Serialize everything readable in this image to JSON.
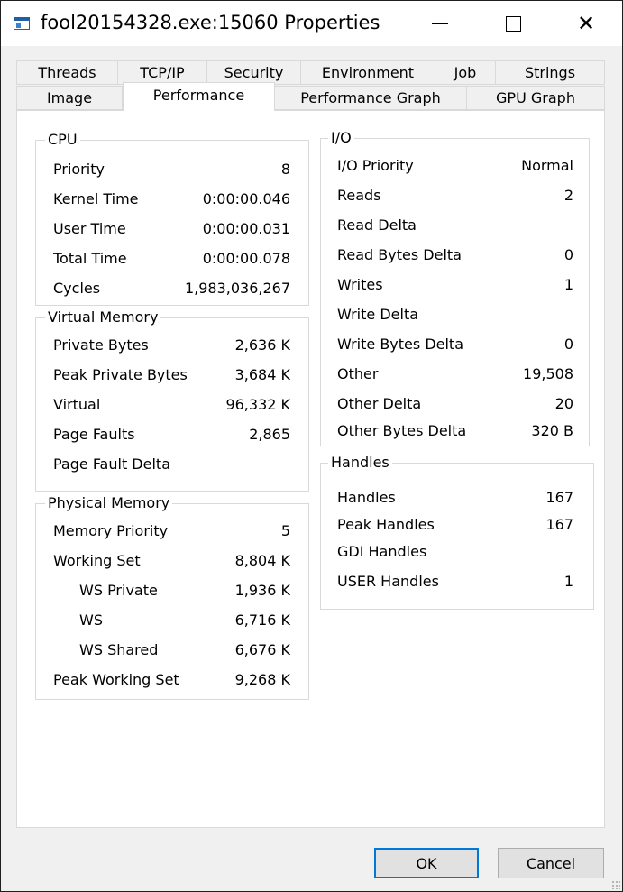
{
  "window": {
    "title": "fool20154328.exe:15060 Properties",
    "minimize_glyph": "",
    "close_glyph": "✕"
  },
  "tabs_row1": [
    "Threads",
    "TCP/IP",
    "Security",
    "Environment",
    "Job",
    "Strings"
  ],
  "tabs_row2": [
    "Image",
    "Performance",
    "Performance Graph",
    "GPU Graph"
  ],
  "active_tab": "Performance",
  "cpu": {
    "title": "CPU",
    "rows": [
      {
        "label": "Priority",
        "value": "8"
      },
      {
        "label": "Kernel Time",
        "value": "0:00:00.046"
      },
      {
        "label": "User Time",
        "value": "0:00:00.031"
      },
      {
        "label": "Total Time",
        "value": "0:00:00.078"
      },
      {
        "label": "Cycles",
        "value": "1,983,036,267"
      }
    ]
  },
  "virtual_memory": {
    "title": "Virtual Memory",
    "rows": [
      {
        "label": "Private Bytes",
        "value": "2,636 K"
      },
      {
        "label": "Peak Private Bytes",
        "value": "3,684 K"
      },
      {
        "label": "Virtual",
        "value": "96,332 K"
      },
      {
        "label": "Page Faults",
        "value": "2,865"
      },
      {
        "label": "Page Fault Delta",
        "value": ""
      }
    ]
  },
  "physical_memory": {
    "title": "Physical Memory",
    "rows": [
      {
        "label": "Memory Priority",
        "value": "5"
      },
      {
        "label": "Working Set",
        "value": "8,804 K"
      },
      {
        "label": "WS Private",
        "value": "1,936 K"
      },
      {
        "label": "WS",
        "value": "6,716 K"
      },
      {
        "label": "WS Shared",
        "value": "6,676 K"
      },
      {
        "label": "Peak Working Set",
        "value": "9,268 K"
      }
    ]
  },
  "io": {
    "title": "I/O",
    "rows": [
      {
        "label": "I/O Priority",
        "value": "Normal"
      },
      {
        "label": "Reads",
        "value": "2"
      },
      {
        "label": "Read Delta",
        "value": ""
      },
      {
        "label": "Read Bytes Delta",
        "value": "0"
      },
      {
        "label": "Writes",
        "value": "1"
      },
      {
        "label": "Write Delta",
        "value": ""
      },
      {
        "label": "Write Bytes Delta",
        "value": "0"
      },
      {
        "label": "Other",
        "value": "19,508"
      },
      {
        "label": "Other Delta",
        "value": "20"
      },
      {
        "label": "Other Bytes Delta",
        "value": "320 B"
      }
    ]
  },
  "handles": {
    "title": "Handles",
    "rows": [
      {
        "label": "Handles",
        "value": "167"
      },
      {
        "label": "Peak Handles",
        "value": "167"
      },
      {
        "label": "GDI Handles",
        "value": ""
      },
      {
        "label": "USER Handles",
        "value": "1"
      }
    ]
  },
  "buttons": {
    "ok": "OK",
    "cancel": "Cancel"
  }
}
